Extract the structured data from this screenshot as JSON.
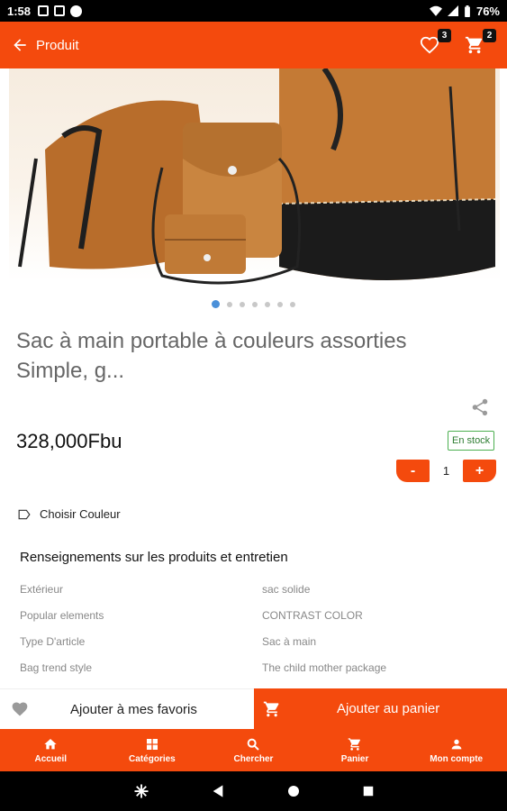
{
  "status_bar": {
    "time": "1:58",
    "battery": "76%"
  },
  "app_bar": {
    "title": "Produit",
    "wishlist_count": "3",
    "cart_count": "2"
  },
  "gallery": {
    "image_alt": "Sac à main portable",
    "slide_count": 7,
    "active_slide": 1
  },
  "product": {
    "title": "Sac à main portable à couleurs assorties Simple, g...",
    "price": "328,000Fbu",
    "stock_status": "En stock",
    "quantity": "1",
    "minus_label": "-",
    "plus_label": "+",
    "choose_color_label": "Choisir Couleur"
  },
  "specs": {
    "title": "Renseignements sur les produits et entretien",
    "rows": [
      {
        "key": "Extérieur",
        "value": "sac solide"
      },
      {
        "key": "Popular elements",
        "value": "CONTRAST COLOR"
      },
      {
        "key": "Type D'article",
        "value": "Sac à main"
      },
      {
        "key": "Bag trend style",
        "value": "The child mother package"
      }
    ]
  },
  "actions": {
    "favorite_label": "Ajouter à mes favoris",
    "add_to_cart_label": "Ajouter au panier"
  },
  "bottom_nav": {
    "items": [
      {
        "label": "Accueil",
        "icon": "home-icon"
      },
      {
        "label": "Catégories",
        "icon": "grid-icon"
      },
      {
        "label": "Chercher",
        "icon": "search-icon"
      },
      {
        "label": "Panier",
        "icon": "cart-icon"
      },
      {
        "label": "Mon compte",
        "icon": "person-icon"
      }
    ]
  },
  "colors": {
    "accent": "#f44a0d",
    "stock_green": "#4caf50",
    "dot_active": "#4a90d9"
  }
}
